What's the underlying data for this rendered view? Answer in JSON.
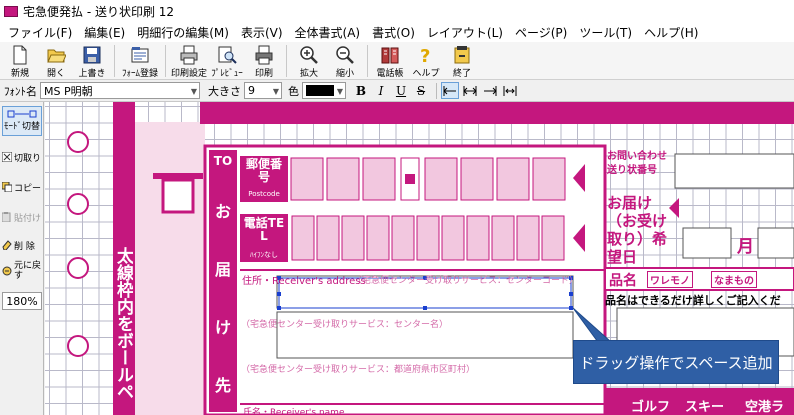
{
  "window": {
    "title": "宅急便発払 - 送り状印刷 12"
  },
  "menu": [
    "ファイル(F)",
    "編集(E)",
    "明細行の編集(M)",
    "表示(V)",
    "全体書式(A)",
    "書式(O)",
    "レイアウト(L)",
    "ページ(P)",
    "ツール(T)",
    "ヘルプ(H)"
  ],
  "toolbar": {
    "new": "新規",
    "open": "開く",
    "overwrite": "上書き",
    "form_register": "ﾌｫｰﾑ登録",
    "print_setting": "印刷設定",
    "preview": "ﾌﾟﾚﾋﾞｭｰ",
    "print": "印刷",
    "zoom_in": "拡大",
    "zoom_out": "縮小",
    "phonebook": "電話帳",
    "help": "ヘルプ",
    "exit": "終了"
  },
  "format": {
    "font_label": "ﾌｫﾝﾄ名",
    "font_value": "MS P明朝",
    "size_label": "大きさ",
    "size_value": "9",
    "color_label": "色",
    "bold": "B",
    "italic": "I",
    "underline": "U",
    "strike": "S"
  },
  "side": {
    "mode": "ﾓｰﾄﾞ切替",
    "cut": "切取り",
    "copy": "コピー",
    "paste": "貼付け",
    "delete": "削 除",
    "undo": "元に戻す",
    "zoom": "180%"
  },
  "form": {
    "vertical_text": "太線枠内をボールペ",
    "to": "TO",
    "to_label_chars": [
      "お",
      "届",
      "け",
      "先"
    ],
    "postal_label": "郵便番号",
    "postal_sub": "Postcode",
    "tel_label": "電話TEL",
    "tel_sub": "ﾊｲﾌﾝなし",
    "inquiry_label": "お問い合わせ送り状番号",
    "delivery_date_label": "お届け（お受け取り）希望日",
    "month": "月",
    "address_label": "住所・Receiver's address",
    "center_code": "（宅急便センター受け取りサービス：センターコード）",
    "center_name": "（宅急便センター受け取りサービス：センター名）",
    "prefecture_line": "（宅急便センター受け取りサービス：都道府県市区町村）",
    "name_label": "氏名・Receiver's name",
    "item_name_label": "品名",
    "fragile": "ワレモノ",
    "perishable": "なまもの",
    "item_hint": "品名はできるだけ詳しくご記入くだ",
    "bottom_tags": [
      "ゴルフ",
      "スキー",
      "空港ラ"
    ]
  },
  "callout": {
    "text": "ドラッグ操作でスペース追加"
  },
  "colors": {
    "brand": "#c4177e",
    "brand_light": "#f2c7df",
    "callout": "#2f5fa5",
    "selection": "#1a3fcf"
  }
}
